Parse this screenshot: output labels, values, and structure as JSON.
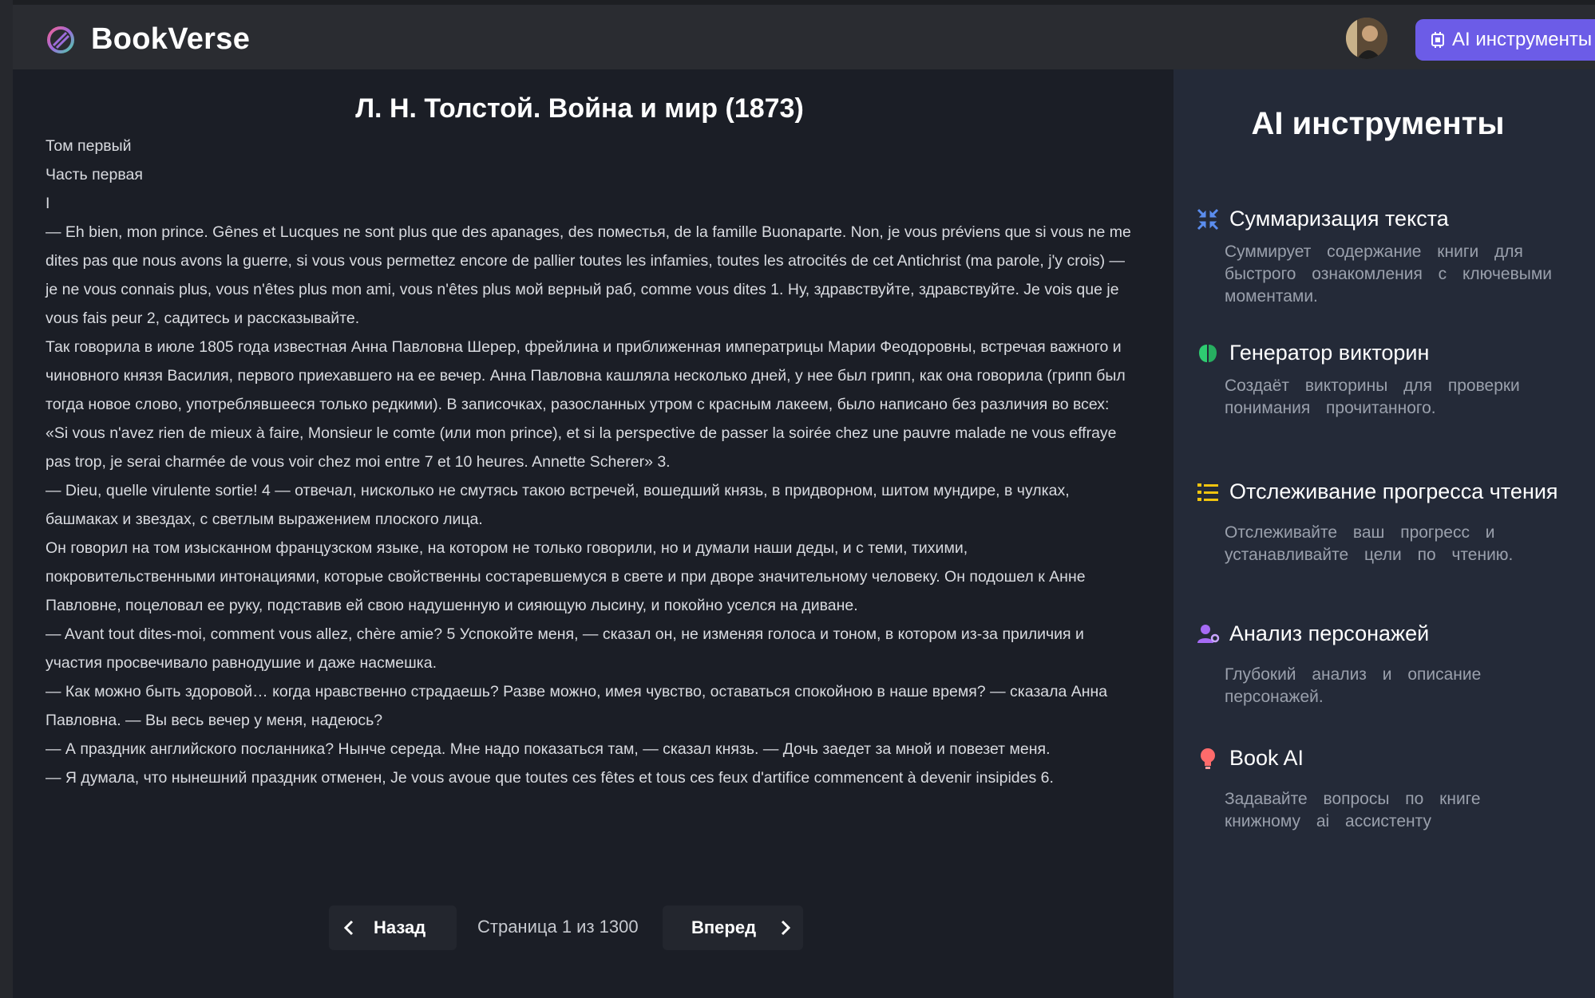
{
  "app": {
    "brand": "BookVerse",
    "ai_button_label": "AI инструменты"
  },
  "book": {
    "title": "Л. Н. Толстой. Война и мир (1873)",
    "paragraphs": [
      "Том первый",
      "Часть первая",
      "I",
      "— Eh bien, mon prince. Gênes et Lucques ne sont plus que des apanages, des поместья, de la famille Buonaparte. Non, je vous préviens que si vous ne me dites pas que nous avons la guerre, si vous vous permettez encore de pallier toutes les infamies, toutes les atrocités de cet Antichrist (ma parole, j'y crois) — je ne vous connais plus, vous n'êtes plus mon ami, vous n'êtes plus мой верный раб, comme vous dites 1. Ну, здравствуйте, здравствуйте. Je vois que je vous fais peur 2, садитесь и рассказывайте.",
      "Так говорила в июле 1805 года известная Анна Павловна Шерер, фрейлина и приближенная императрицы Марии Феодоровны, встречая важного и чиновного князя Василия, первого приехавшего на ее вечер. Анна Павловна кашляла несколько дней, у нее был грипп, как она говорила (грипп был тогда новое слово, употреблявшееся только редкими). В записочках, разосланных утром с красным лакеем, было написано без различия во всех:",
      "«Si vous n'avez rien de mieux à faire, Monsieur le comte (или mon prince), et si la perspective de passer la soirée chez une pauvre malade ne vous effraye pas trop, je serai charmée de vous voir chez moi entre 7 et 10 heures. Annette Scherer» 3.",
      "— Dieu, quelle virulente sortie! 4 — отвечал, нисколько не смутясь такою встречей, вошедший князь, в придворном, шитом мундире, в чулках, башмаках и звездах, с светлым выражением плоского лица.",
      "Он говорил на том изысканном французском языке, на котором не только говорили, но и думали наши деды, и с теми, тихими, покровительственными интонациями, которые свойственны состаревшемуся в свете и при дворе значительному человеку. Он подошел к Анне Павловне, поцеловал ее руку, подставив ей свою надушенную и сияющую лысину, и покойно уселся на диване.",
      "— Avant tout dites-moi, comment vous allez, chère amie? 5 Успокойте меня, — сказал он, не изменяя голоса и тоном, в котором из-за приличия и участия просвечивало равнодушие и даже насмешка.",
      "— Как можно быть здоровой… когда нравственно страдаешь? Разве можно, имея чувство, оставаться спокойною в наше время? — сказала Анна Павловна. — Вы весь вечер у меня, надеюсь?",
      "— А праздник английского посланника? Нынче середа. Мне надо показаться там, — сказал князь. — Дочь заедет за мной и повезет меня.",
      "— Я думала, что нынешний праздник отменен, Je vous avoue que toutes ces fêtes et tous ces feux d'artifice commencent à devenir insipides 6."
    ]
  },
  "pager": {
    "prev_label": "Назад",
    "next_label": "Вперед",
    "page_info": "Страница 1 из 1300",
    "current_page": 1,
    "total_pages": 1300
  },
  "panel": {
    "title": "AI инструменты",
    "tools": [
      {
        "icon": "compress-arrows-icon",
        "name": "Суммаризация текста",
        "desc": "Суммирует содержание книги для быстрого ознакомления с ключевыми моментами."
      },
      {
        "icon": "brain-icon",
        "name": "Генератор викторин",
        "desc": "Создаёт викторины для проверки понимания прочитанного."
      },
      {
        "icon": "list-check-icon",
        "name": "Отслеживание прогресса чтения",
        "desc": "Отслеживайте ваш прогресс и устанавливайте цели по чтению."
      },
      {
        "icon": "user-gear-icon",
        "name": "Анализ персонажей",
        "desc": "Глубокий анализ и описание персонажей."
      },
      {
        "icon": "lightbulb-icon",
        "name": "Book AI",
        "desc": "Задавайте вопросы по книге книжному ai ассистенту"
      }
    ]
  },
  "colors": {
    "accent": "#6c5ce7",
    "background": "#1b1e26",
    "panel": "#242a38"
  }
}
